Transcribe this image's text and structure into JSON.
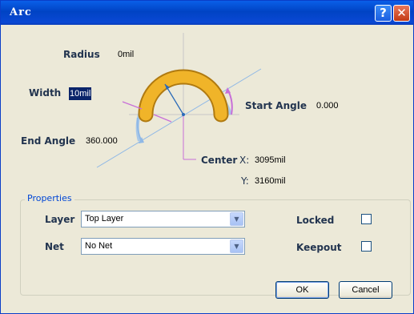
{
  "window": {
    "title": "Arc",
    "help": "?",
    "close": "✕"
  },
  "radius": {
    "label": "Radius",
    "value": "0mil"
  },
  "width": {
    "label": "Width",
    "value": "10mil"
  },
  "start_angle": {
    "label": "Start Angle",
    "value": "0.000"
  },
  "end_angle": {
    "label": "End Angle",
    "value": "360.000"
  },
  "center": {
    "label": "Center",
    "x_label": "X:",
    "x_value": "3095mil",
    "y_label": "Y:",
    "y_value": "3160mil"
  },
  "properties": {
    "legend": "Properties",
    "layer_label": "Layer",
    "layer_value": "Top Layer",
    "net_label": "Net",
    "net_value": "No Net",
    "locked_label": "Locked",
    "keepout_label": "Keepout"
  },
  "buttons": {
    "ok": "OK",
    "cancel": "Cancel"
  },
  "icons": {
    "combo_arrow": "chevron-down-icon"
  },
  "colors": {
    "arc_fill": "#f0b429",
    "arc_outline": "#b07a10",
    "guide_blue": "#8fb8e6",
    "guide_magenta": "#c86fd8",
    "titlebar": "#0a49d4"
  }
}
